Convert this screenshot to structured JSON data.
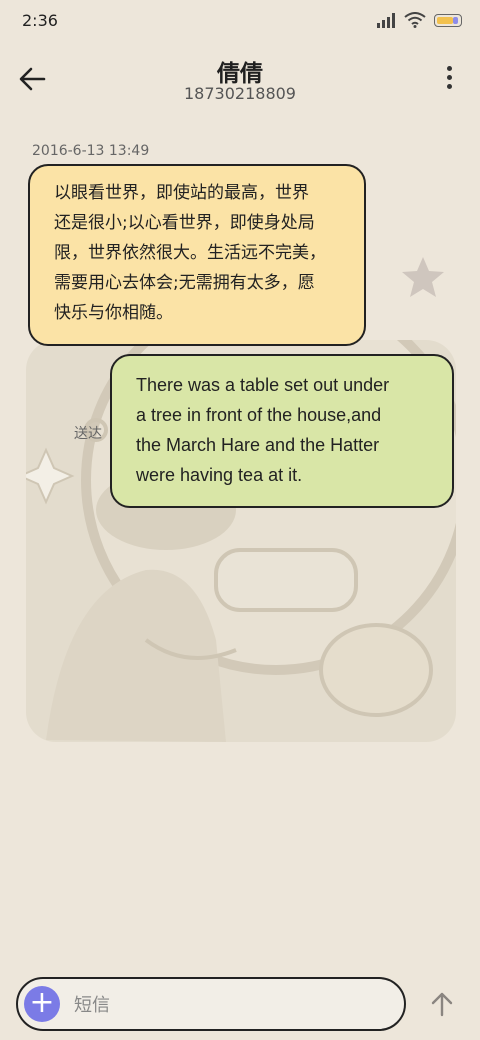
{
  "status_bar": {
    "time": "2:36",
    "icons": [
      "signal-icon",
      "wifi-icon",
      "battery-icon"
    ],
    "battery_colors": [
      "#F2C14E",
      "#8D8CE8"
    ]
  },
  "header": {
    "contact_name": "倩倩",
    "contact_number": "18730218809",
    "icons": [
      "back-arrow-icon",
      "more-vertical-icon"
    ]
  },
  "conversation": {
    "timestamp": "2016-6-13 13:49",
    "received": {
      "lines": [
        "以眼看世界，即使站的最高，世界",
        "还是很小;以心看世界，即使身处局",
        "限，世界依然很大。生活远不完美，",
        "需要用心去体会;无需拥有太多，愿",
        "快乐与你相随。"
      ],
      "color": "#FBE3A6"
    },
    "sent": {
      "lines": [
        "There was a table set out under",
        "a tree in front of the house,and",
        "the March Hare and the Hatter",
        "were having tea at it."
      ],
      "status": "送达",
      "color": "#D9E6A7"
    }
  },
  "composer": {
    "placeholder": "短信",
    "add_icon": "plus-icon",
    "send_icon": "arrow-up-icon",
    "accent": "#7B7BE6"
  }
}
